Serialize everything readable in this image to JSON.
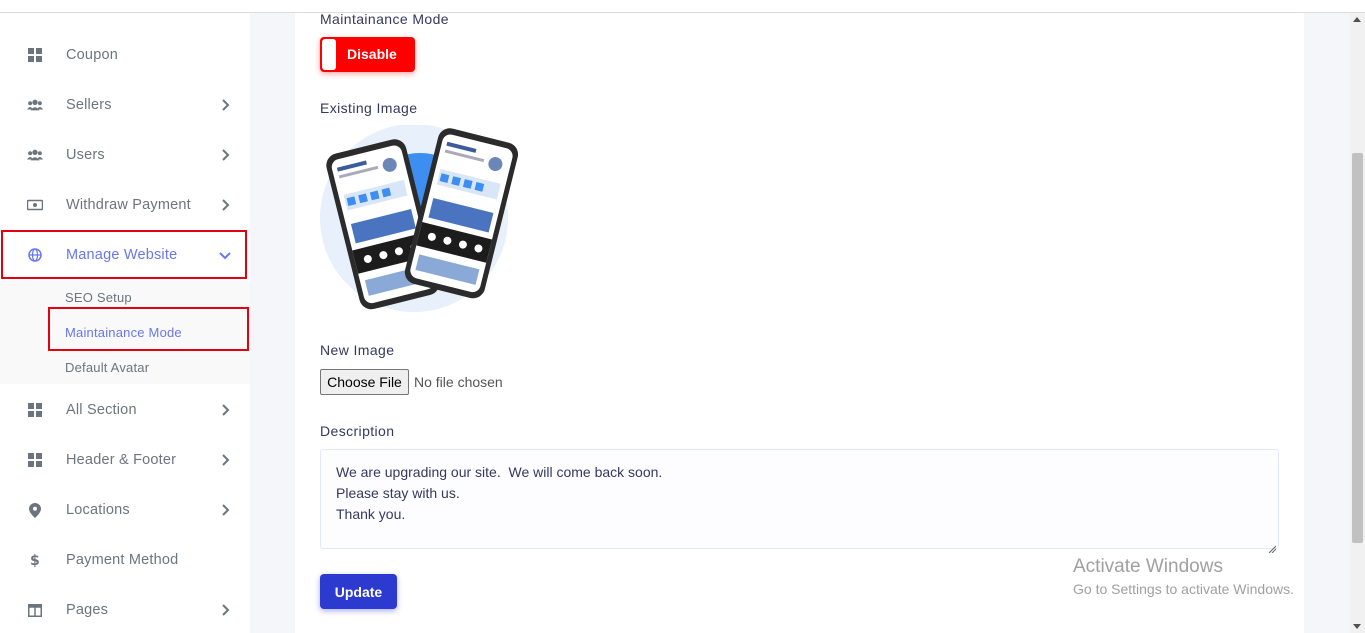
{
  "sidebar": {
    "items": [
      {
        "label": "Coupon",
        "icon": "grid-icon"
      },
      {
        "label": "Sellers",
        "icon": "users-icon"
      },
      {
        "label": "Users",
        "icon": "users-icon"
      },
      {
        "label": "Withdraw Payment",
        "icon": "money-bill-icon"
      },
      {
        "label": "Manage Website",
        "icon": "globe-icon"
      },
      {
        "label": "All Section",
        "icon": "grid-icon"
      },
      {
        "label": "Header & Footer",
        "icon": "grid-icon"
      },
      {
        "label": "Locations",
        "icon": "map-marker-icon"
      },
      {
        "label": "Payment Method",
        "icon": "dollar-icon"
      },
      {
        "label": "Pages",
        "icon": "columns-icon"
      }
    ],
    "submenu": [
      {
        "label": "SEO Setup"
      },
      {
        "label": "Maintainance Mode"
      },
      {
        "label": "Default Avatar"
      }
    ]
  },
  "form": {
    "maintenance_label": "Maintainance Mode",
    "toggle_label": "Disable",
    "existing_image_label": "Existing Image",
    "new_image_label": "New Image",
    "choose_file_label": "Choose File",
    "file_status": "No file chosen",
    "description_label": "Description",
    "description_lines": [
      "We are upgrading our site.  We will come back soon.",
      "Please stay with us.",
      "Thank you."
    ],
    "update_label": "Update"
  },
  "watermark": {
    "title": "Activate Windows",
    "subtitle": "Go to Settings to activate Windows."
  },
  "colors": {
    "accent": "#6777ef",
    "toggle_off": "#ff0000",
    "primary_button": "#2c3ad0",
    "highlight": "#e3000f"
  }
}
